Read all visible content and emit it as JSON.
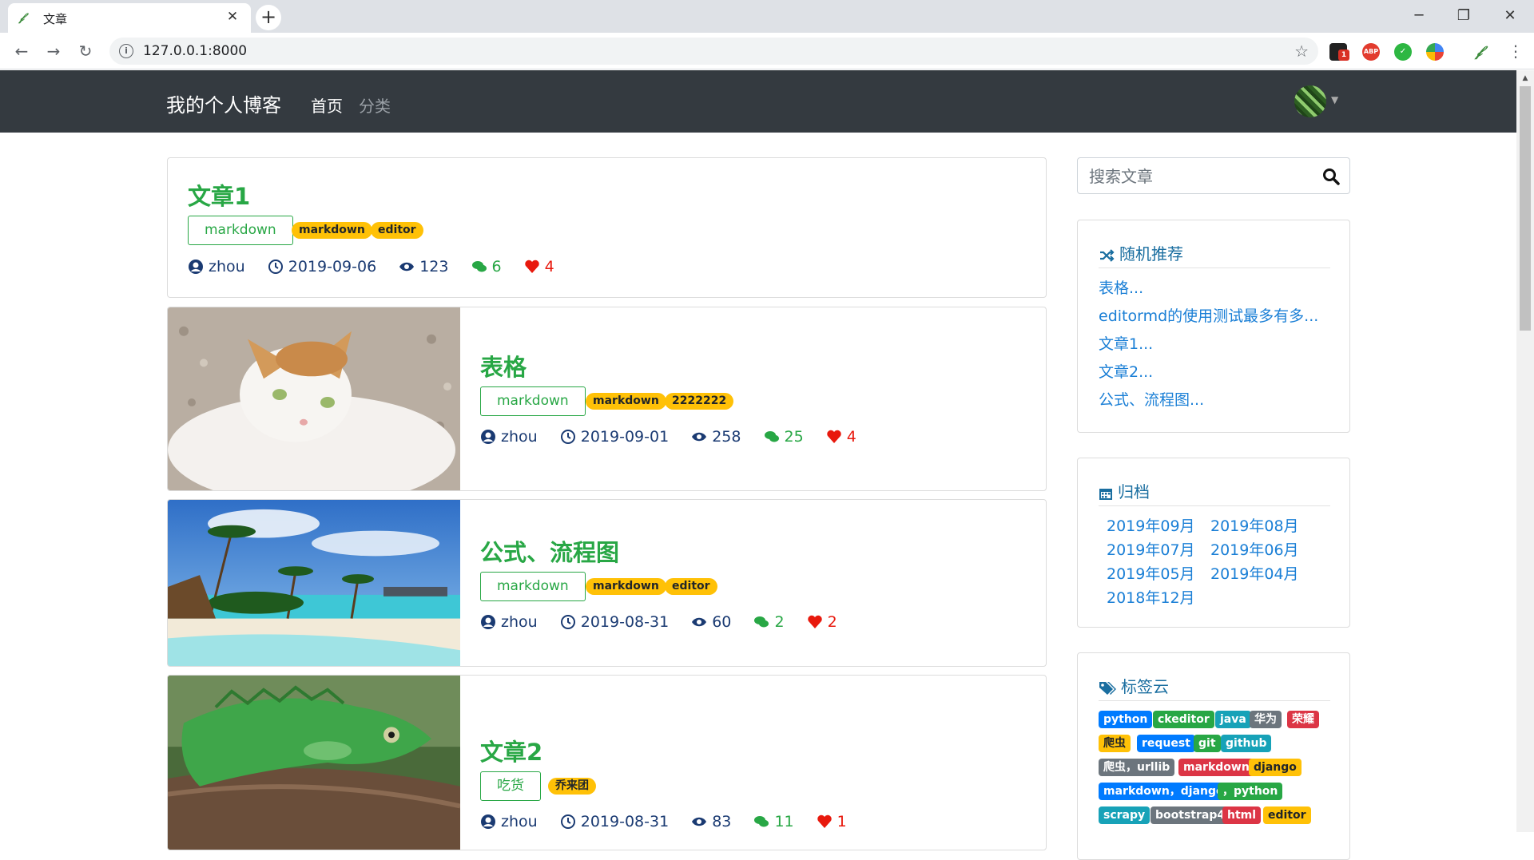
{
  "browser": {
    "tab_title": "文章",
    "url": "127.0.0.1:8000",
    "extensions": [
      "1",
      "ABP"
    ]
  },
  "navbar": {
    "brand": "我的个人博客",
    "links": [
      "首页",
      "分类"
    ]
  },
  "articles": [
    {
      "title": "文章1",
      "category": "markdown",
      "tags": [
        "markdown",
        "editor"
      ],
      "author": "zhou",
      "date": "2019-09-06",
      "views": "123",
      "comments": "6",
      "likes": "4"
    },
    {
      "title": "表格",
      "category": "markdown",
      "tags": [
        "markdown",
        "2222222"
      ],
      "author": "zhou",
      "date": "2019-09-01",
      "views": "258",
      "comments": "25",
      "likes": "4"
    },
    {
      "title": "公式、流程图",
      "category": "markdown",
      "tags": [
        "markdown",
        "editor"
      ],
      "author": "zhou",
      "date": "2019-08-31",
      "views": "60",
      "comments": "2",
      "likes": "2"
    },
    {
      "title": "文章2",
      "category": "吃货",
      "tags": [
        "乔来团"
      ],
      "author": "zhou",
      "date": "2019-08-31",
      "views": "83",
      "comments": "11",
      "likes": "1"
    }
  ],
  "sidebar": {
    "search_placeholder": "搜索文章",
    "random": {
      "title": "随机推荐",
      "items": [
        "表格...",
        "editormd的使用测试最多有多...",
        "文章1...",
        "文章2...",
        "公式、流程图..."
      ]
    },
    "archive": {
      "title": "归档",
      "items": [
        "2019年09月",
        "2019年08月",
        "2019年07月",
        "2019年06月",
        "2019年05月",
        "2019年04月",
        "2018年12月"
      ]
    },
    "tag_cloud": {
      "title": "标签云",
      "tags": [
        {
          "label": "python",
          "color": "#007bff"
        },
        {
          "label": "ckeditor",
          "color": "#28a745"
        },
        {
          "label": "java",
          "color": "#17a2b8"
        },
        {
          "label": "华为",
          "color": "#6c757d"
        },
        {
          "label": "荣耀",
          "color": "#dc3545"
        },
        {
          "label": "爬虫",
          "color": "#ffc107"
        },
        {
          "label": "request",
          "color": "#007bff"
        },
        {
          "label": "git",
          "color": "#28a745"
        },
        {
          "label": "github",
          "color": "#17a2b8"
        },
        {
          "label": "爬虫，urllib",
          "color": "#6c757d"
        },
        {
          "label": "markdown",
          "color": "#dc3545"
        },
        {
          "label": "django",
          "color": "#ffc107"
        },
        {
          "label": "markdown，django",
          "color": "#007bff"
        },
        {
          "label": "，python",
          "color": "#28a745"
        },
        {
          "label": "scrapy",
          "color": "#17a2b8"
        },
        {
          "label": "bootstrap4",
          "color": "#6c757d"
        },
        {
          "label": "html",
          "color": "#dc3545"
        },
        {
          "label": "editor",
          "color": "#ffc107"
        }
      ]
    }
  }
}
